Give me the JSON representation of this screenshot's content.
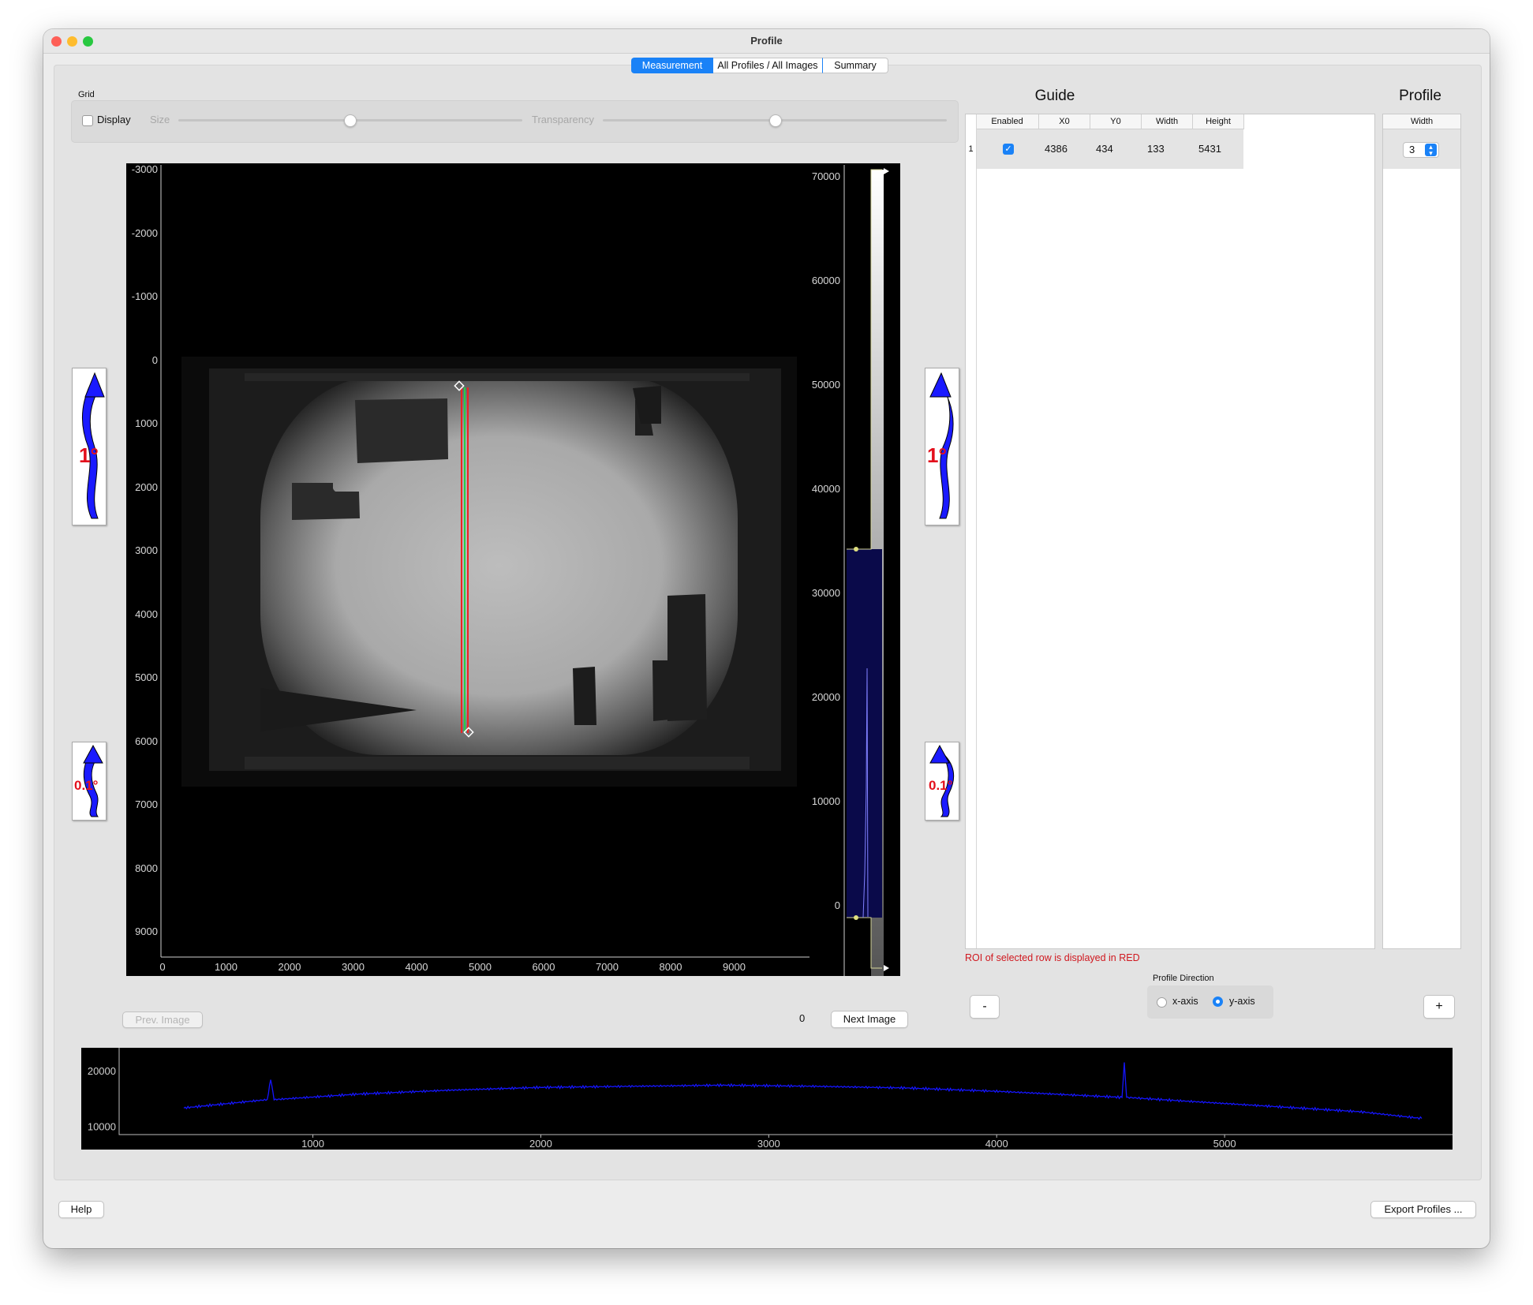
{
  "window": {
    "title": "Profile"
  },
  "tabs": [
    {
      "label": "Measurement",
      "active": true
    },
    {
      "label": "All Profiles / All Images",
      "active": false
    },
    {
      "label": "Summary",
      "active": false
    }
  ],
  "grid": {
    "section_label": "Grid",
    "display_label": "Display",
    "display_checked": false,
    "size_label": "Size",
    "size_value": 0.5,
    "transparency_label": "Transparency",
    "transparency_value": 0.5
  },
  "image_view": {
    "y_ticks": [
      "-3000",
      "-2000",
      "-1000",
      "0",
      "1000",
      "2000",
      "3000",
      "4000",
      "5000",
      "6000",
      "7000",
      "8000",
      "9000"
    ],
    "x_ticks": [
      "0",
      "1000",
      "2000",
      "3000",
      "4000",
      "5000",
      "6000",
      "7000",
      "8000",
      "9000"
    ],
    "histogram_ticks": [
      "70000",
      "60000",
      "50000",
      "40000",
      "30000",
      "20000",
      "10000",
      "0"
    ]
  },
  "rotate_buttons": {
    "large_label": "1°",
    "small_label": "0.1°"
  },
  "nav": {
    "prev_label": "Prev. Image",
    "index": "0",
    "next_label": "Next Image"
  },
  "guide": {
    "title": "Guide",
    "columns": [
      "Enabled",
      "X0",
      "Y0",
      "Width",
      "Height"
    ],
    "rows": [
      {
        "index": "1",
        "enabled": true,
        "x0": "4386",
        "y0": "434",
        "width": "133",
        "height": "5431"
      }
    ],
    "note": "ROI of selected row is displayed in RED"
  },
  "profile": {
    "title": "Profile",
    "column": "Width",
    "width_value": "3",
    "direction_label": "Profile Direction",
    "options": [
      "x-axis",
      "y-axis"
    ],
    "selected": "y-axis"
  },
  "controls": {
    "minus_label": "-",
    "plus_label": "+"
  },
  "chart_data": {
    "type": "line",
    "x_ticks": [
      "1000",
      "2000",
      "3000",
      "4000",
      "5000"
    ],
    "y_ticks": [
      "20000",
      "10000"
    ],
    "xlim": [
      150,
      6000
    ],
    "ylim": [
      8500,
      23000
    ],
    "color": "#1515ff",
    "series": [
      {
        "x": [
          434,
          800,
          815,
          830,
          1200,
          1600,
          2000,
          2400,
          2800,
          3200,
          3600,
          4000,
          4400,
          4550,
          4560,
          4570,
          4800,
          5200,
          5600,
          5865
        ],
        "y": [
          13300,
          14800,
          18500,
          14800,
          15800,
          16500,
          17000,
          17200,
          17400,
          17200,
          16900,
          16300,
          15500,
          15200,
          21500,
          15200,
          14600,
          13600,
          12600,
          11400
        ]
      }
    ]
  },
  "footer": {
    "help_label": "Help",
    "export_label": "Export Profiles ..."
  }
}
